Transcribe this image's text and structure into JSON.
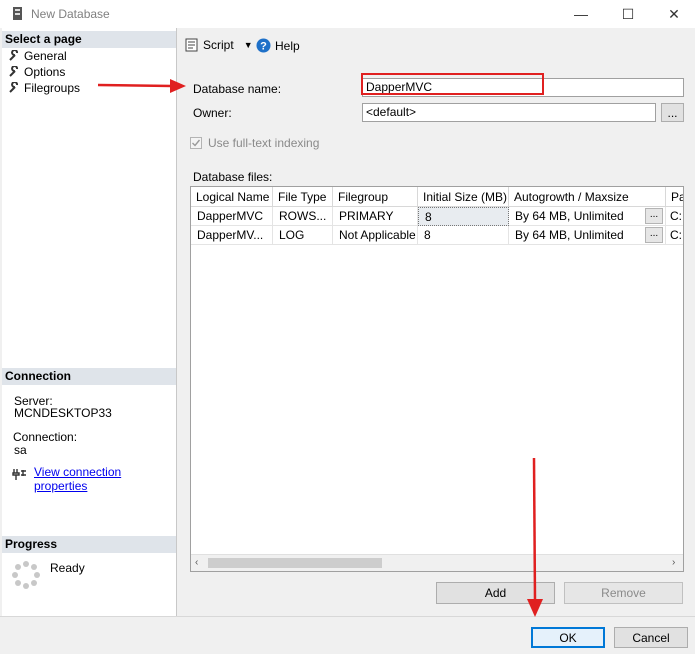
{
  "window": {
    "title": "New Database",
    "minimize": "—",
    "maximize": "☐",
    "close": "✕"
  },
  "left": {
    "select_page_header": "Select a page",
    "pages": [
      {
        "label": "General"
      },
      {
        "label": "Options"
      },
      {
        "label": "Filegroups"
      }
    ],
    "connection_header": "Connection",
    "server_label": "Server:",
    "server_value": "MCNDESKTOP33",
    "connection_label": "Connection:",
    "connection_value": "sa",
    "view_connection_link": "View connection properties",
    "progress_header": "Progress",
    "progress_status": "Ready"
  },
  "toolbar": {
    "script_label": "Script",
    "help_label": "Help"
  },
  "form": {
    "database_name_label": "Database name:",
    "database_name_value": "DapperMVC",
    "owner_label": "Owner:",
    "owner_value": "<default>",
    "fulltext_label": "Use full-text indexing",
    "database_files_label": "Database files:"
  },
  "grid": {
    "columns": [
      "Logical Name",
      "File Type",
      "Filegroup",
      "Initial Size (MB)",
      "Autogrowth / Maxsize",
      "Pa"
    ],
    "rows": [
      [
        "DapperMVC",
        "ROWS...",
        "PRIMARY",
        "8",
        "By 64 MB, Unlimited",
        "C:"
      ],
      [
        "DapperMV...",
        "LOG",
        "Not Applicable",
        "8",
        "By 64 MB, Unlimited",
        "C:"
      ]
    ],
    "ellipsis": "..."
  },
  "buttons": {
    "add": "Add",
    "remove": "Remove",
    "ok": "OK",
    "cancel": "Cancel",
    "owner_browse": "..."
  },
  "colors": {
    "annotation_red": "#e02020",
    "link_blue": "#0000ee",
    "header_bg": "#dfe4ea"
  }
}
